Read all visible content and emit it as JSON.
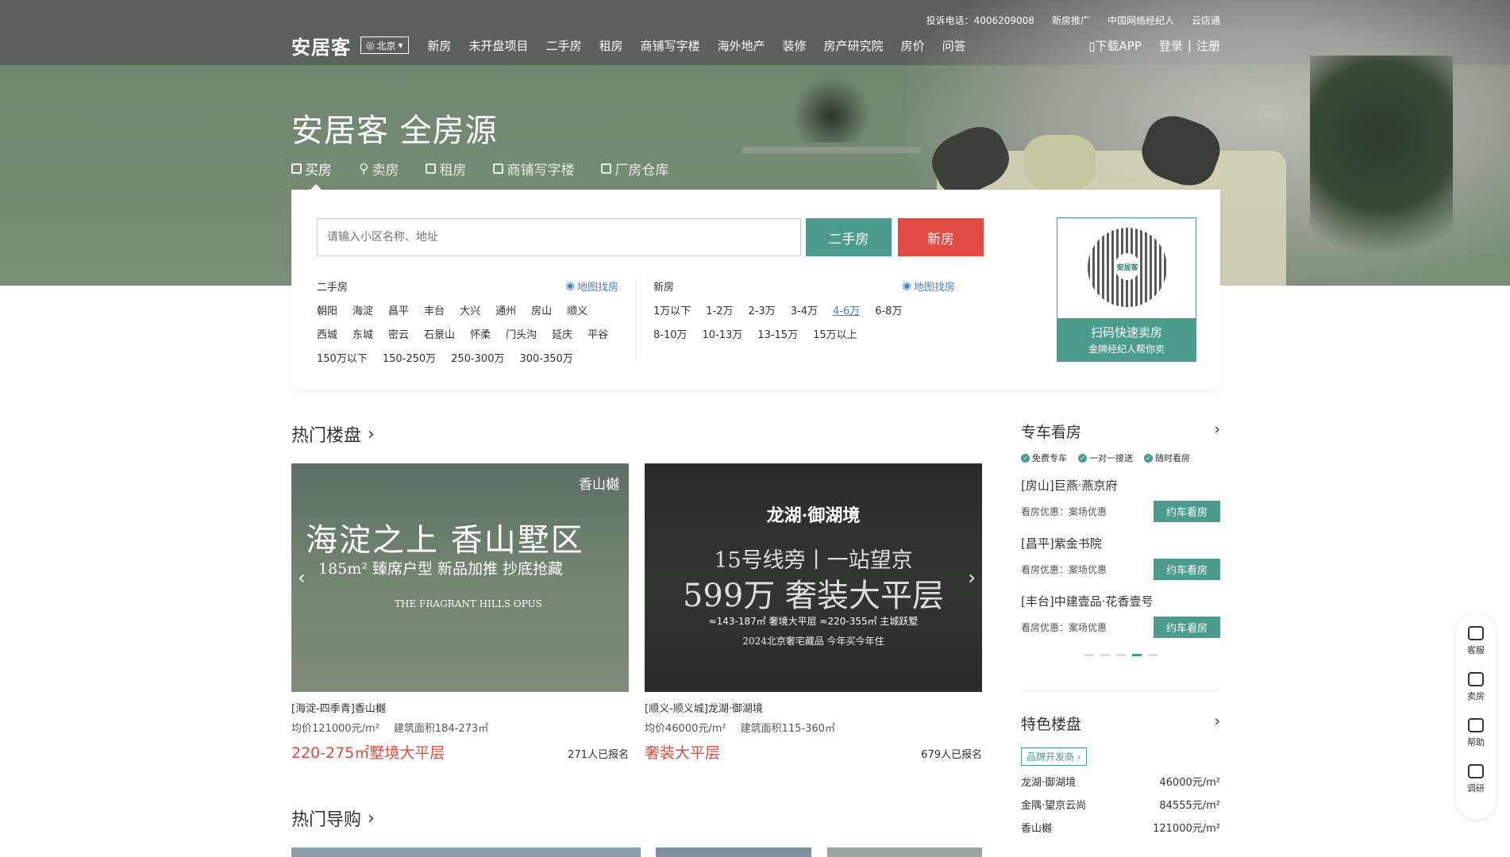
{
  "top": {
    "util": [
      "投诉电话：4006209008",
      "新房推广",
      "中国网络经纪人",
      "云店通"
    ],
    "logo": "安居客",
    "city": "北京",
    "nav": [
      "新房",
      "未开盘项目",
      "二手房",
      "租房",
      "商铺写字楼",
      "海外地产",
      "装修",
      "房产研究院",
      "房价",
      "问答"
    ],
    "download": "下载APP",
    "login": "登录",
    "register": "注册"
  },
  "hero": {
    "title": "安居客 全房源",
    "tabs": [
      "买房",
      "卖房",
      "租房",
      "商铺写字楼",
      "厂房仓库"
    ]
  },
  "search": {
    "placeholder": "请输入小区名称、地址",
    "btn_esf": "二手房",
    "btn_xf": "新房",
    "esf": {
      "title": "二手房",
      "map": "地图找房",
      "rows": [
        [
          "朝阳",
          "海淀",
          "昌平",
          "丰台",
          "大兴",
          "通州",
          "房山",
          "顺义"
        ],
        [
          "西城",
          "东城",
          "密云",
          "石景山",
          "怀柔",
          "门头沟",
          "延庆",
          "平谷"
        ],
        [
          "150万以下",
          "150-250万",
          "250-300万",
          "300-350万"
        ]
      ]
    },
    "xf": {
      "title": "新房",
      "map": "地图找房",
      "rows": [
        [
          "1万以下",
          "1-2万",
          "2-3万",
          "3-4万",
          "4-6万",
          "6-8万"
        ],
        [
          "8-10万",
          "10-13万",
          "13-15万",
          "15万以上"
        ]
      ]
    },
    "qr": {
      "logo_text": "安居客",
      "line1": "扫码快速卖房",
      "line2": "金牌经纪人帮你卖"
    }
  },
  "hot": {
    "title": "热门楼盘",
    "cards": [
      {
        "img_brand": "香山樾",
        "img_t1": "海淀之上 香山墅区",
        "img_t2": "185m² 臻席户型 新品加推 抄底抢藏",
        "img_t3": "THE FRAGRANT HILLS OPUS",
        "meta1": "[海淀-四季青]香山樾",
        "price": "均价121000元/m²",
        "area": "建筑面积184-273㎡",
        "tag": "220-275㎡墅境大平层",
        "count": "271人已报名"
      },
      {
        "img_b1": "龙湖·御湖境",
        "img_b2": "15号线旁丨一站望京",
        "img_b3": "599万 奢装大平层",
        "img_b4": "≈143-187㎡ 奢境大平层 ≈220-355㎡ 主城跃墅",
        "img_b5": "2024北京奢宅藏品 今年买今年住",
        "meta1": "[顺义-顺义城]龙湖·御湖境",
        "price": "均价46000元/m²",
        "area": "建筑面积115-360㎡",
        "tag": "奢装大平层",
        "count": "679人已报名"
      }
    ]
  },
  "car": {
    "title": "专车看房",
    "perks": [
      "免费专车",
      "一对一接送",
      "随时看房"
    ],
    "items": [
      {
        "name": "[房山]巨燕·燕京府",
        "offer": "看房优惠：案场优惠",
        "btn": "约车看房"
      },
      {
        "name": "[昌平]紫金书院",
        "offer": "看房优惠：案场优惠",
        "btn": "约车看房"
      },
      {
        "name": "[丰台]中建壹品·花香壹号",
        "offer": "看房优惠：案场优惠",
        "btn": "约车看房"
      }
    ]
  },
  "featured": {
    "title": "特色楼盘",
    "pill": "品牌开发商",
    "list": [
      {
        "name": "龙湖·御湖境",
        "price": "46000元/m²"
      },
      {
        "name": "金隅·望京云尚",
        "price": "84555元/m²"
      },
      {
        "name": "香山樾",
        "price": "121000元/m²"
      }
    ]
  },
  "side": [
    "客服",
    "卖房",
    "帮助",
    "调研"
  ],
  "guide": {
    "title": "热门导购"
  }
}
